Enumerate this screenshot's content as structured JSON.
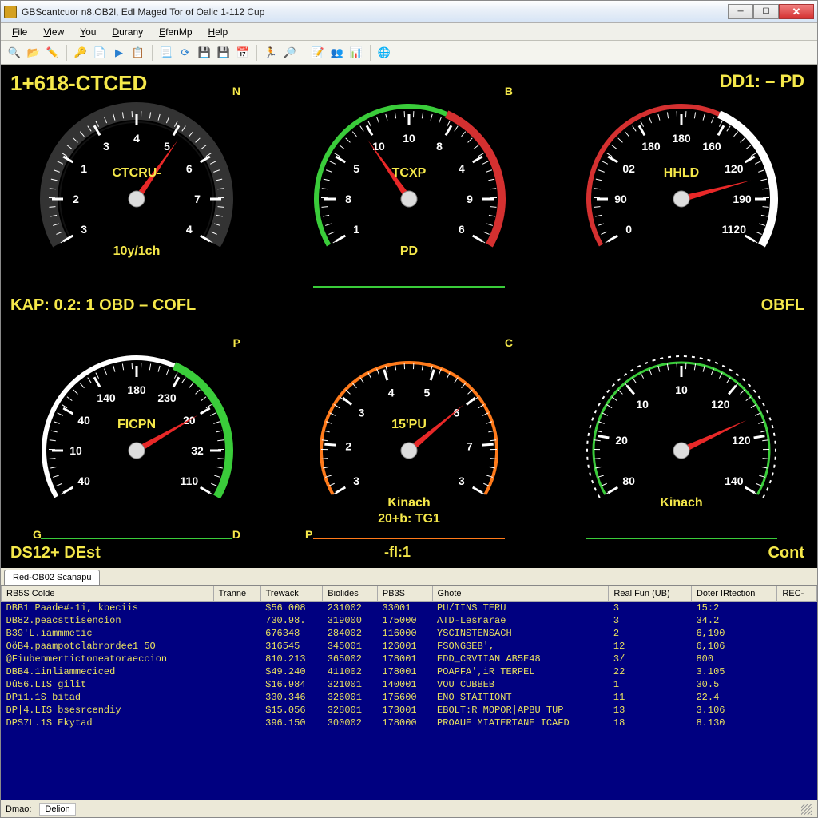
{
  "window": {
    "title": "GBScantcuor n8.OB2l, Edl Maged Tor of Oalic 1-112 Cup"
  },
  "menubar": [
    "File",
    "View",
    "You",
    "Durany",
    "EfenMp",
    "Help"
  ],
  "toolbar_icons": [
    "search-icon",
    "folder-open-icon",
    "wand-icon",
    "key-icon",
    "copy-icon",
    "play-icon",
    "save-icon",
    "page-icon",
    "refresh-icon",
    "disk-icon",
    "disk2-icon",
    "calendar-icon",
    "run-icon",
    "zoom-icon",
    "doc-icon",
    "users-icon",
    "chart-icon",
    "globe-icon"
  ],
  "dash": {
    "header_left": "1+618-CTCED",
    "header_right": "DD1: – PD",
    "map_line": "KAP: 0.2: 1 OBD – COFL",
    "ds_line": "DS12+ DEst",
    "fl_line": "-fl:1",
    "cont": "Cont",
    "obfl": "OBFL",
    "gauges": [
      {
        "id": "g1",
        "name": "CTCRU-",
        "corner": "N",
        "sub": "10y/1ch",
        "ticks": [
          "3",
          "2",
          "1",
          "3",
          "4",
          "5",
          "6",
          "7",
          "4"
        ],
        "needle": -55,
        "style": "dark"
      },
      {
        "id": "g2",
        "name": "TCXP",
        "corner": "B",
        "sub": "PD",
        "ticks": [
          "1",
          "8",
          "5",
          "10",
          "10",
          "8",
          "4",
          "9",
          "6"
        ],
        "needle": -125,
        "style": "red-green"
      },
      {
        "id": "g3",
        "name": "HHLD",
        "corner": "",
        "sub": "",
        "ticks": [
          "0",
          "90",
          "02",
          "180",
          "180",
          "160",
          "120",
          "190",
          "1120"
        ],
        "needle": -15,
        "style": "white-red"
      },
      {
        "id": "g4",
        "name": "FICPN",
        "corner": "P",
        "sub": "",
        "ticks": [
          "40",
          "10",
          "40",
          "140",
          "180",
          "230",
          "20",
          "32",
          "110"
        ],
        "needle": -30,
        "style": "green-white",
        "gl": "G",
        "gr": "D"
      },
      {
        "id": "g5",
        "name": "15'PU",
        "corner": "C",
        "sub": "Kinach",
        "sub2": "20+b: TG1",
        "ticks": [
          "3",
          "2",
          "3",
          "4",
          "5",
          "6",
          "7",
          "3"
        ],
        "needle": -40,
        "style": "orange",
        "gl": "P"
      },
      {
        "id": "g6",
        "name": "",
        "corner": "",
        "sub": "Kinach",
        "ticks": [
          "80",
          "20",
          "10",
          "10",
          "120",
          "120",
          "140"
        ],
        "needle": -25,
        "style": "green-dash"
      }
    ]
  },
  "tab": "Red-OB02 Scanapu",
  "table": {
    "columns": [
      "RB5S Colde",
      "Tranne",
      "Trewack",
      "Biolides",
      "PB3S",
      "Ghote",
      "Real Fun (UB)",
      "Doter IRtection",
      "REC-"
    ],
    "rows": [
      [
        "DBB1 Paade#-1i, kbeciis",
        "",
        "$56 008",
        "231002",
        "33001",
        "PU/IINS TERU",
        "3",
        "15:2",
        ""
      ],
      [
        "DB82.peacsttisencion",
        "",
        "730.98.",
        "319000",
        "175000",
        "ATD-Lesrarae",
        "3",
        "34.2",
        ""
      ],
      [
        "B39'L.iammmetic",
        "",
        "676348",
        "284002",
        "116000",
        "YSCINSTENSACH",
        "2",
        "6,190",
        ""
      ],
      [
        "OöB4.paampotclabrordee1 5O",
        "",
        "316545",
        "345001",
        "126001",
        "FSONGSEB',",
        "12",
        "6,106",
        ""
      ],
      [
        "@Fiubenmertictoneatoraeccion",
        "",
        "810.213",
        "365002",
        "178001",
        "EDD_CRVIIAN AB5E48",
        "3/",
        "800",
        ""
      ],
      [
        "DBB4.1inliammeciced",
        "",
        "$49.240",
        "411002",
        "178001",
        "POAPFA',iR TERPEL",
        "22",
        "3.105",
        ""
      ],
      [
        "Dû56.LIS gilit",
        "",
        "$16.984",
        "321001",
        "140001",
        "VOU CUBBEB",
        "1",
        "30.5",
        ""
      ],
      [
        "DPi1.1S bitad",
        "",
        "330.346",
        "326001",
        "175600",
        "ENO STAITIONT",
        "11",
        "22.4",
        ""
      ],
      [
        "DP|4.LIS bsesrcendiy",
        "",
        "$15.056",
        "328001",
        "173001",
        "EBOLT:R MOPOR|APBU TUP",
        "13",
        "3.106",
        ""
      ],
      [
        "DPS7L.1S Ekytad",
        "",
        "396.150",
        "300002",
        "178000",
        "PROAUE MIATERTANE ICAFD",
        "18",
        "8.130",
        ""
      ]
    ]
  },
  "status": {
    "label": "Dmao:",
    "value": "Delion"
  }
}
